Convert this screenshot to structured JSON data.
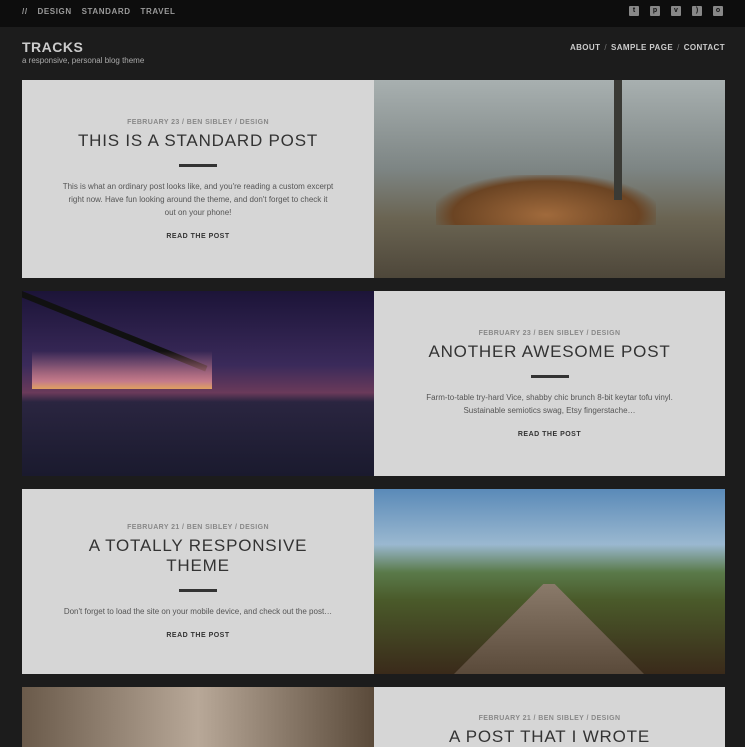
{
  "topbar": {
    "prefix": "//",
    "categories": [
      "DESIGN",
      "STANDARD",
      "TRAVEL"
    ],
    "social": [
      "twitter-icon",
      "pinterest-icon",
      "vimeo-icon",
      "rss-icon",
      "instagram-icon"
    ]
  },
  "site": {
    "title": "TRACKS",
    "tagline": "a responsive, personal blog theme"
  },
  "nav": [
    "ABOUT",
    "SAMPLE PAGE",
    "CONTACT"
  ],
  "posts": [
    {
      "meta": "FEBRUARY 23 / BEN SIBLEY / DESIGN",
      "title": "THIS IS A STANDARD POST",
      "excerpt": "This is what an ordinary post looks like, and you're reading a custom excerpt right now. Have fun looking around the theme, and don't forget to check it out on your phone!",
      "more": "READ THE POST"
    },
    {
      "meta": "FEBRUARY 23 / BEN SIBLEY / DESIGN",
      "title": "ANOTHER AWESOME POST",
      "excerpt": "Farm-to-table try-hard Vice, shabby chic brunch 8-bit keytar tofu vinyl. Sustainable semiotics swag, Etsy fingerstache…",
      "more": "READ THE POST"
    },
    {
      "meta": "FEBRUARY 21 / BEN SIBLEY / DESIGN",
      "title": "A TOTALLY RESPONSIVE THEME",
      "excerpt": "Don't forget to load the site on your mobile device, and check out the post…",
      "more": "READ THE POST"
    },
    {
      "meta": "FEBRUARY 21 / BEN SIBLEY / DESIGN",
      "title": "A POST THAT I WROTE"
    }
  ]
}
